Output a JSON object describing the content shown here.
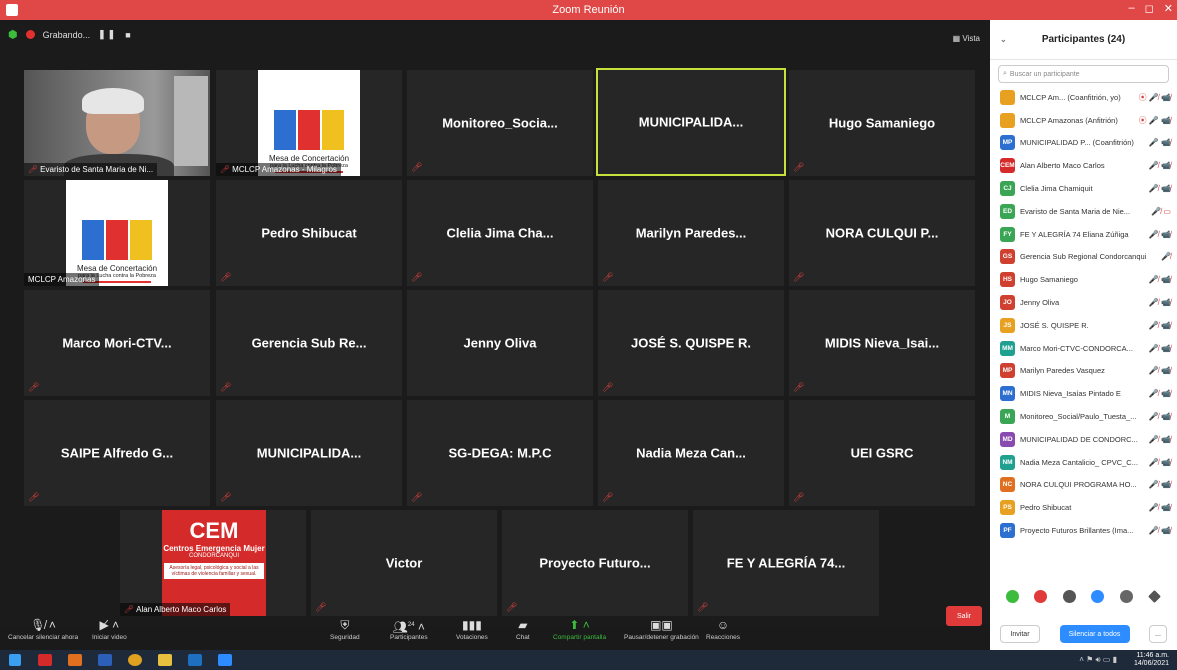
{
  "window": {
    "title": "Zoom Reunión",
    "controls": [
      "–",
      "◻",
      "✕"
    ]
  },
  "recording": {
    "label": "Grabando...",
    "pause": "❚❚",
    "stop": "■"
  },
  "view_label": "▦ Vista",
  "tiles": {
    "t1": "Evaristo de Santa Maria de Ni...",
    "t2": "MCLCP Amazonas - Milagros",
    "t3": "Monitoreo_Socia...",
    "t4": "MUNICIPALIDA...",
    "t5": "Hugo Samaniego",
    "t6": "MCLCP Amazonas",
    "t7": "Pedro Shibucat",
    "t8": "Clelia Jima Cha...",
    "t9": "Marilyn Paredes...",
    "t10": "NORA CULQUI P...",
    "t11": "Marco Mori-CTV...",
    "t12": "Gerencia Sub Re...",
    "t13": "Jenny Oliva",
    "t14": "JOSÉ S. QUISPE R.",
    "t15": "MIDIS Nieva_Isai...",
    "t16": "SAIPE Alfredo G...",
    "t17": "MUNICIPALIDA...",
    "t18": "SG-DEGA: M.P.C",
    "t19": "Nadia Meza Can...",
    "t20": "UEI GSRC",
    "t21": "Alan Alberto Maco Carlos",
    "t22": "Victor",
    "t23": "Proyecto Futuro...",
    "t24": "FE Y ALEGRÍA 74..."
  },
  "logo": {
    "title": "Mesa de Concertación",
    "subtitle": "para la Lucha contra la Pobreza"
  },
  "cem": {
    "title": "CEM",
    "subtitle": "Centros Emergencia Mujer",
    "city": "CONDORCANQUI",
    "box": "Asesoría legal, psicológica y social a las víctimas de violencia familiar y sexual."
  },
  "toolbar": {
    "mute": "Cancelar silenciar ahora",
    "video": "Iniciar video",
    "security": "Seguridad",
    "participants": "Participantes",
    "participants_count": "24",
    "polls": "Votaciones",
    "chat": "Chat",
    "share": "Compartir pantalla",
    "record": "Pausar/detener grabación",
    "reactions": "Reacciones",
    "leave": "Salir"
  },
  "panel": {
    "title": "Participantes (24)",
    "search_placeholder": "Buscar un participante",
    "invite": "Invitar",
    "mute_all": "Silenciar a todos",
    "more": "..."
  },
  "participants": [
    {
      "initials": "",
      "color": "#e8a020",
      "name": "MCLCP Am... (Coanfitrión, yo)",
      "icons": "⦿ 🎤̸ 📹̸"
    },
    {
      "initials": "",
      "color": "#e8a020",
      "name": "MCLCP Amazonas (Anfitrión)",
      "icons": "⦿ 🎤 📹̸"
    },
    {
      "initials": "MP",
      "color": "#2d6fd0",
      "name": "MUNICIPALIDAD P... (Coanfitrión)",
      "icons": "🎤 📹̸"
    },
    {
      "initials": "CEM",
      "color": "#d42a2a",
      "name": "Alan Alberto Maco Carlos",
      "icons": "🎤̸ 📹̸"
    },
    {
      "initials": "CJ",
      "color": "#3aa655",
      "name": "Clelia Jima Chamiquit",
      "icons": "🎤̸ 📹̸"
    },
    {
      "initials": "ED",
      "color": "#3aa655",
      "name": "Evaristo de Santa Maria de Nie...",
      "icons": "🎤̸ ▭"
    },
    {
      "initials": "FY",
      "color": "#3aa655",
      "name": "FE Y ALEGRÍA 74 Eliana Zúñiga",
      "icons": "🎤̸ 📹̸"
    },
    {
      "initials": "GS",
      "color": "#d04030",
      "name": "Gerencia Sub Regional Condorcanqui",
      "icons": "🎤̸"
    },
    {
      "initials": "HS",
      "color": "#d04030",
      "name": "Hugo Samaniego",
      "icons": "🎤̸ 📹̸"
    },
    {
      "initials": "JO",
      "color": "#d04030",
      "name": "Jenny Oliva",
      "icons": "🎤̸ 📹̸"
    },
    {
      "initials": "JS",
      "color": "#e8a020",
      "name": "JOSÉ S. QUISPE R.",
      "icons": "🎤̸ 📹̸"
    },
    {
      "initials": "MM",
      "color": "#20a090",
      "name": "Marco Mori-CTVC-CONDORCA...",
      "icons": "🎤̸ 📹̸"
    },
    {
      "initials": "MP",
      "color": "#d04030",
      "name": "Marilyn Paredes Vasquez",
      "icons": "🎤̸ 📹̸"
    },
    {
      "initials": "MN",
      "color": "#2d6fd0",
      "name": "MIDIS Nieva_Isaías Pintado E",
      "icons": "🎤̸ 📹̸"
    },
    {
      "initials": "M",
      "color": "#3aa655",
      "name": "Monitoreo_Social/Paulo_Tuesta_...",
      "icons": "🎤̸ 📹̸"
    },
    {
      "initials": "MD",
      "color": "#8a4bb0",
      "name": "MUNICIPALIDAD DE CONDORC...",
      "icons": "🎤̸ 📹̸"
    },
    {
      "initials": "NM",
      "color": "#20a090",
      "name": "Nadia Meza Cantalicio_ CPVC_C...",
      "icons": "🎤̸ 📹̸"
    },
    {
      "initials": "NC",
      "color": "#e07020",
      "name": "NORA CULQUI PROGRAMA HO...",
      "icons": "🎤̸ 📹̸"
    },
    {
      "initials": "PS",
      "color": "#e8a020",
      "name": "Pedro Shibucat",
      "icons": "🎤̸ 📹̸"
    },
    {
      "initials": "PF",
      "color": "#2d6fd0",
      "name": "Proyecto Futuros Brillantes (Ima...",
      "icons": "🎤̸ 📹̸"
    }
  ],
  "clock": {
    "time": "11:46 a.m.",
    "date": "14/06/2021"
  },
  "colors": {
    "accent": "#2d8cff",
    "leave": "#e03a3a",
    "active_speaker": "#c8e03c",
    "muted": "#e04040"
  }
}
